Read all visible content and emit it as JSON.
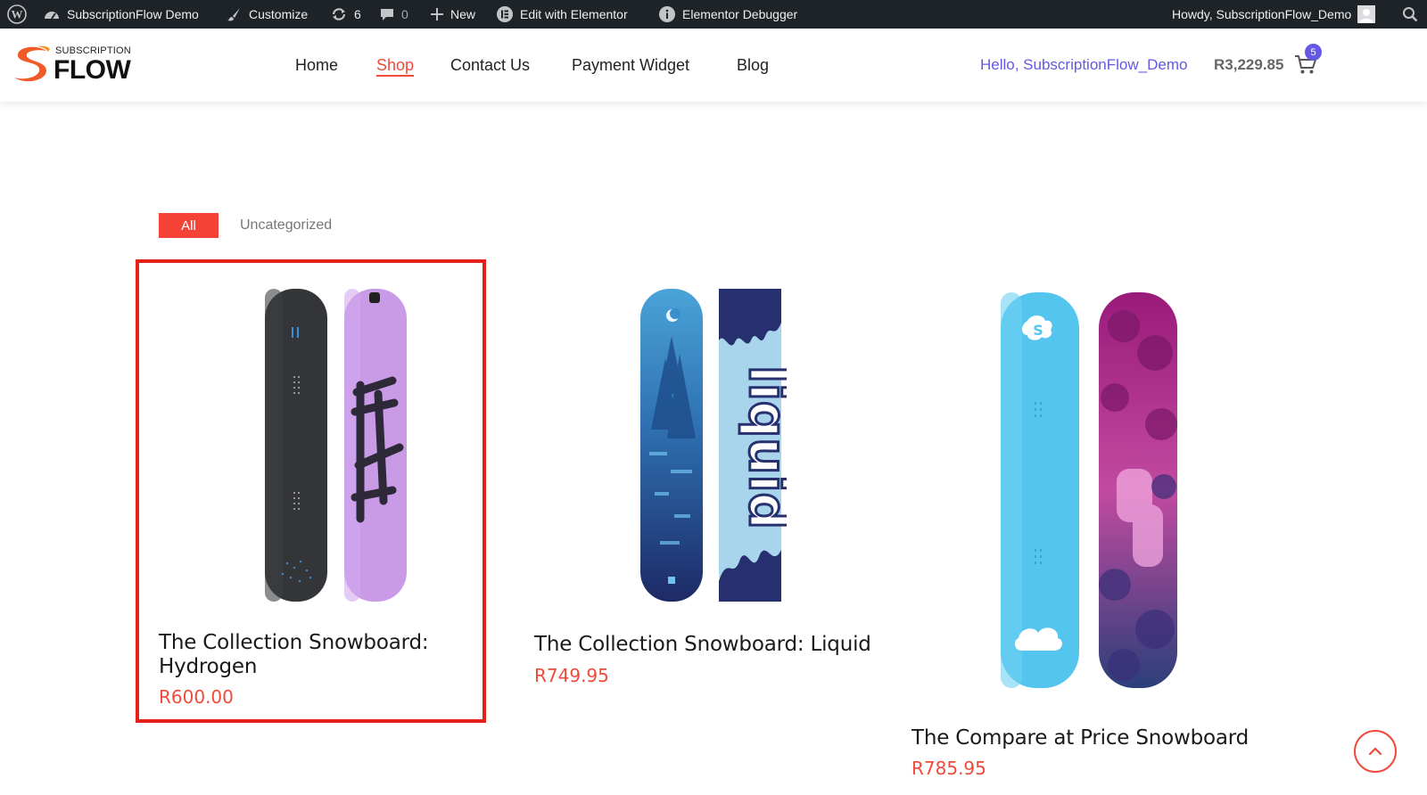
{
  "adminbar": {
    "site_name": "SubscriptionFlow Demo",
    "customize": "Customize",
    "updates_count": "6",
    "comments_count": "0",
    "new": "New",
    "edit_elementor": "Edit with Elementor",
    "debugger": "Elementor Debugger",
    "howdy": "Howdy, SubscriptionFlow_Demo"
  },
  "logo": {
    "top": "SUBSCRIPTION",
    "main": "FLOW"
  },
  "nav": {
    "items": [
      {
        "label": "Home"
      },
      {
        "label": "Shop",
        "active": true
      },
      {
        "label": "Contact Us"
      },
      {
        "label": "Payment Widget"
      },
      {
        "label": "Blog"
      }
    ]
  },
  "account": {
    "hello": "Hello, SubscriptionFlow_Demo",
    "cart_total": "R3,229.85",
    "cart_count": "5"
  },
  "filters": {
    "all": "All",
    "uncategorized": "Uncategorized"
  },
  "products": [
    {
      "title_line1": "The Collection Snowboard:",
      "title_line2": "Hydrogen",
      "price": "R600.00"
    },
    {
      "title": "The Collection Snowboard: Liquid",
      "price": "R749.95"
    },
    {
      "title": "The Compare at Price Snowboard",
      "price": "R785.95"
    }
  ],
  "colors": {
    "accent": "#ef4a3a",
    "highlight_border": "#e62117",
    "link_purple": "#6458e6",
    "adminbar_bg": "#1d2327"
  }
}
